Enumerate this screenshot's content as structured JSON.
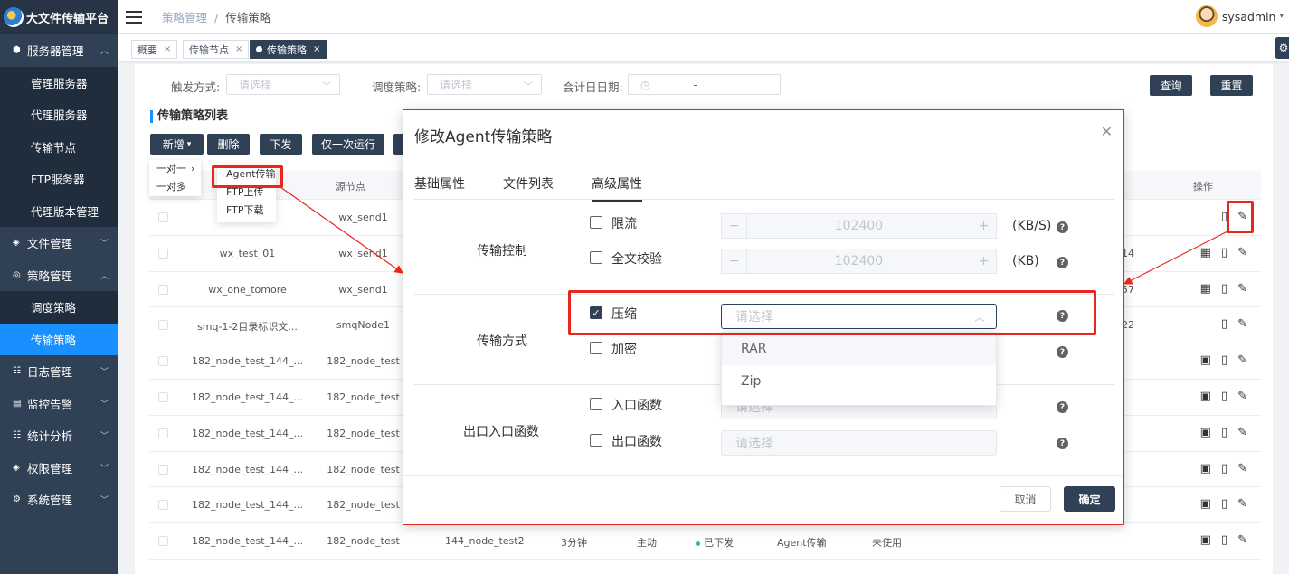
{
  "app": {
    "title": "大文件传输平台"
  },
  "sidebar": {
    "groups": [
      {
        "label": "服务器管理",
        "icon": "cube-icon",
        "expanded": true,
        "items": [
          "管理服务器",
          "代理服务器",
          "传输节点",
          "FTP服务器",
          "代理版本管理"
        ]
      },
      {
        "label": "文件管理",
        "icon": "layers-icon",
        "expanded": false
      },
      {
        "label": "策略管理",
        "icon": "strategy-icon",
        "expanded": true,
        "items": [
          "调度策略",
          "传输策略"
        ]
      },
      {
        "label": "日志管理",
        "icon": "log-icon",
        "expanded": false
      },
      {
        "label": "监控告警",
        "icon": "monitor-icon",
        "expanded": false
      },
      {
        "label": "统计分析",
        "icon": "stats-icon",
        "expanded": false
      },
      {
        "label": "权限管理",
        "icon": "permission-icon",
        "expanded": false
      },
      {
        "label": "系统管理",
        "icon": "gear-icon",
        "expanded": false
      }
    ],
    "active_item": "传输策略"
  },
  "header": {
    "breadcrumb": [
      "策略管理",
      "传输策略"
    ],
    "separator": "/",
    "user": "sysadmin"
  },
  "tags": [
    {
      "label": "概要",
      "active": false
    },
    {
      "label": "传输节点",
      "active": false
    },
    {
      "label": "传输策略",
      "active": true
    }
  ],
  "filters": {
    "trigger": {
      "label": "触发方式:",
      "placeholder": "请选择"
    },
    "schedule": {
      "label": "调度策略:",
      "placeholder": "请选择"
    },
    "date": {
      "label": "会计日日期:",
      "separator": "-"
    },
    "query_button": "查询",
    "reset_button": "重置"
  },
  "list": {
    "title": "传输策略列表",
    "toolbar": {
      "add": "新增",
      "delete": "删除",
      "deploy": "下发",
      "run_once": "仅一次运行"
    },
    "add_menu": {
      "items": [
        "一对一",
        "一对多"
      ],
      "submenu": [
        "Agent传输",
        "FTP上传",
        "FTP下载"
      ]
    },
    "columns": {
      "source": "源节点",
      "ops": "操作"
    },
    "rows": [
      {
        "name": "",
        "source": "wx_send1",
        "extra": "",
        "ops": [
          "doc",
          "edit"
        ]
      },
      {
        "name": "wx_test_01",
        "source": "wx_send1",
        "extra": "14",
        "ops": [
          "calendar",
          "doc",
          "edit"
        ]
      },
      {
        "name": "wx_one_tomore",
        "source": "wx_send1",
        "extra": "57",
        "ops": [
          "calendar",
          "doc",
          "edit"
        ]
      },
      {
        "name": "smq-1-2目录标识文...",
        "source": "smqNode1",
        "extra": "22",
        "ops": [
          "doc",
          "edit"
        ]
      },
      {
        "name": "182_node_test_144_...",
        "source": "182_node_test",
        "extra": "",
        "ops": [
          "log",
          "doc",
          "edit"
        ]
      },
      {
        "name": "182_node_test_144_...",
        "source": "182_node_test",
        "extra": "",
        "ops": [
          "log",
          "doc",
          "edit"
        ]
      },
      {
        "name": "182_node_test_144_...",
        "source": "182_node_test",
        "extra": "",
        "ops": [
          "log",
          "doc",
          "edit"
        ]
      },
      {
        "name": "182_node_test_144_...",
        "source": "182_node_test",
        "extra": "",
        "ops": [
          "log",
          "doc",
          "edit"
        ]
      },
      {
        "name": "182_node_test_144_...",
        "source": "182_node_test",
        "extra": "",
        "ops": [
          "log",
          "doc",
          "edit"
        ]
      },
      {
        "name": "182_node_test_144_...",
        "source": "182_node_test",
        "target": "144_node_test2",
        "interval": "3分钟",
        "mode": "主动",
        "status": "已下发",
        "type": "Agent传输",
        "usage": "未使用",
        "ops": [
          "log",
          "doc",
          "edit"
        ]
      }
    ]
  },
  "dialog": {
    "title": "修改Agent传输策略",
    "tabs": [
      "基础属性",
      "文件列表",
      "高级属性"
    ],
    "active_tab": "高级属性",
    "sections": {
      "transfer_control": {
        "label": "传输控制",
        "rate_limit": {
          "label": "限流",
          "value": "102400",
          "unit": "(KB/S)",
          "checked": false
        },
        "checksum": {
          "label": "全文校验",
          "value": "102400",
          "unit": "(KB)",
          "checked": false
        }
      },
      "transfer_mode": {
        "label": "传输方式",
        "compress": {
          "label": "压缩",
          "checked": true,
          "placeholder": "请选择",
          "options": [
            "RAR",
            "Zip"
          ]
        },
        "encrypt": {
          "label": "加密",
          "checked": false
        }
      },
      "functions": {
        "label": "出口入口函数",
        "entry": {
          "label": "入口函数",
          "checked": false,
          "placeholder": "请选择"
        },
        "exit": {
          "label": "出口函数",
          "checked": false,
          "placeholder": "请选择"
        }
      }
    },
    "cancel": "取消",
    "confirm": "确定",
    "step_minus": "−",
    "step_plus": "+",
    "help": "?"
  },
  "colors": {
    "sidebar": "#304156",
    "active": "#1890ff",
    "annotation": "#e8261c"
  }
}
